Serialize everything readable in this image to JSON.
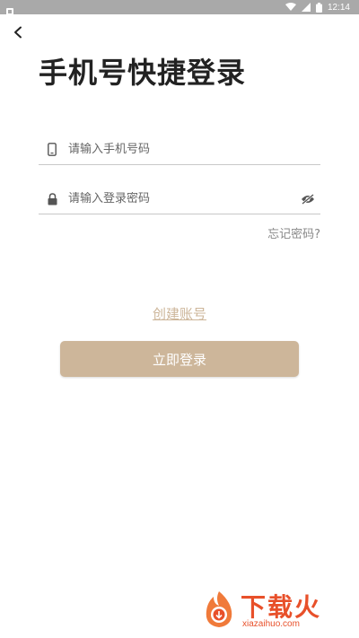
{
  "status_bar": {
    "time": "12:14"
  },
  "header": {
    "title": "手机号快捷登录"
  },
  "form": {
    "phone_placeholder": "请输入手机号码",
    "password_placeholder": "请输入登录密码",
    "forgot_label": "忘记密码?"
  },
  "actions": {
    "create_account_label": "创建账号",
    "login_label": "立即登录"
  },
  "watermark": {
    "brand": "下载火",
    "domain": "xiazaihuo.com"
  },
  "colors": {
    "accent": "#cdb69a",
    "status_bar": "#a9a9a9",
    "watermark": "#e8502a"
  }
}
